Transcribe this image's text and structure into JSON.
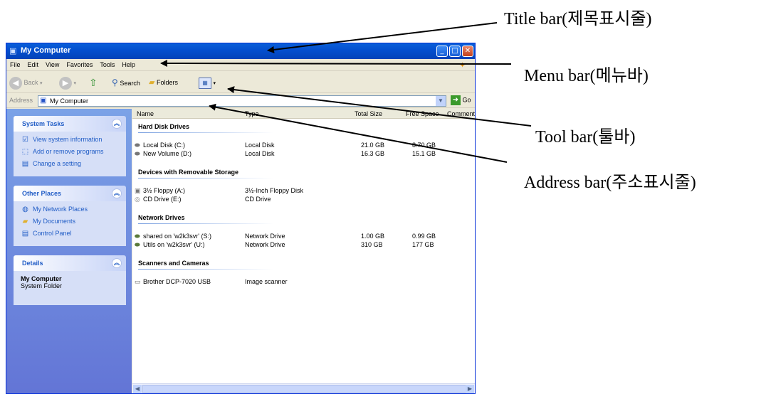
{
  "window": {
    "title": "My Computer",
    "controls": {
      "minimize": "_",
      "maximize": "□",
      "close": "✕"
    }
  },
  "menubar": {
    "items": [
      "File",
      "Edit",
      "View",
      "Favorites",
      "Tools",
      "Help"
    ]
  },
  "toolbar": {
    "back": "Back",
    "search": "Search",
    "folders": "Folders",
    "views_icon": "views-icon"
  },
  "addressbar": {
    "label": "Address",
    "value": "My Computer",
    "go": "Go"
  },
  "leftpane": {
    "system_tasks": {
      "title": "System Tasks",
      "items": [
        "View system information",
        "Add or remove programs",
        "Change a setting"
      ]
    },
    "other_places": {
      "title": "Other Places",
      "items": [
        "My Network Places",
        "My Documents",
        "Control Panel"
      ]
    },
    "details": {
      "title": "Details",
      "name": "My Computer",
      "type": "System Folder"
    }
  },
  "columns": [
    "Name",
    "Type",
    "Total Size",
    "Free Space",
    "Comments"
  ],
  "groups": [
    {
      "title": "Hard Disk Drives",
      "rows": [
        {
          "name": "Local Disk (C:)",
          "type": "Local Disk",
          "total": "21.0 GB",
          "free": "8.70 GB"
        },
        {
          "name": "New Volume (D:)",
          "type": "Local Disk",
          "total": "16.3 GB",
          "free": "15.1 GB"
        }
      ]
    },
    {
      "title": "Devices with Removable Storage",
      "rows": [
        {
          "name": "3½ Floppy (A:)",
          "type": "3½-Inch Floppy Disk",
          "total": "",
          "free": ""
        },
        {
          "name": "CD Drive (E:)",
          "type": "CD Drive",
          "total": "",
          "free": ""
        }
      ]
    },
    {
      "title": "Network Drives",
      "rows": [
        {
          "name": "shared on 'w2k3svr' (S:)",
          "type": "Network Drive",
          "total": "1.00 GB",
          "free": "0.99 GB"
        },
        {
          "name": "Utils on 'w2k3svr' (U:)",
          "type": "Network Drive",
          "total": "310 GB",
          "free": "177 GB"
        }
      ]
    },
    {
      "title": "Scanners and Cameras",
      "rows": [
        {
          "name": "Brother DCP-7020 USB",
          "type": "Image scanner",
          "total": "",
          "free": ""
        }
      ]
    }
  ],
  "annotations": {
    "title_bar": "Title bar(제목표시줄)",
    "menu_bar": "Menu bar(메뉴바)",
    "tool_bar": "Tool bar(툴바)",
    "address_bar": "Address bar(주소표시줄)"
  },
  "colors": {
    "xp_blue": "#0450d0",
    "task_pane": "#6f8ee0",
    "link": "#215dc6"
  }
}
